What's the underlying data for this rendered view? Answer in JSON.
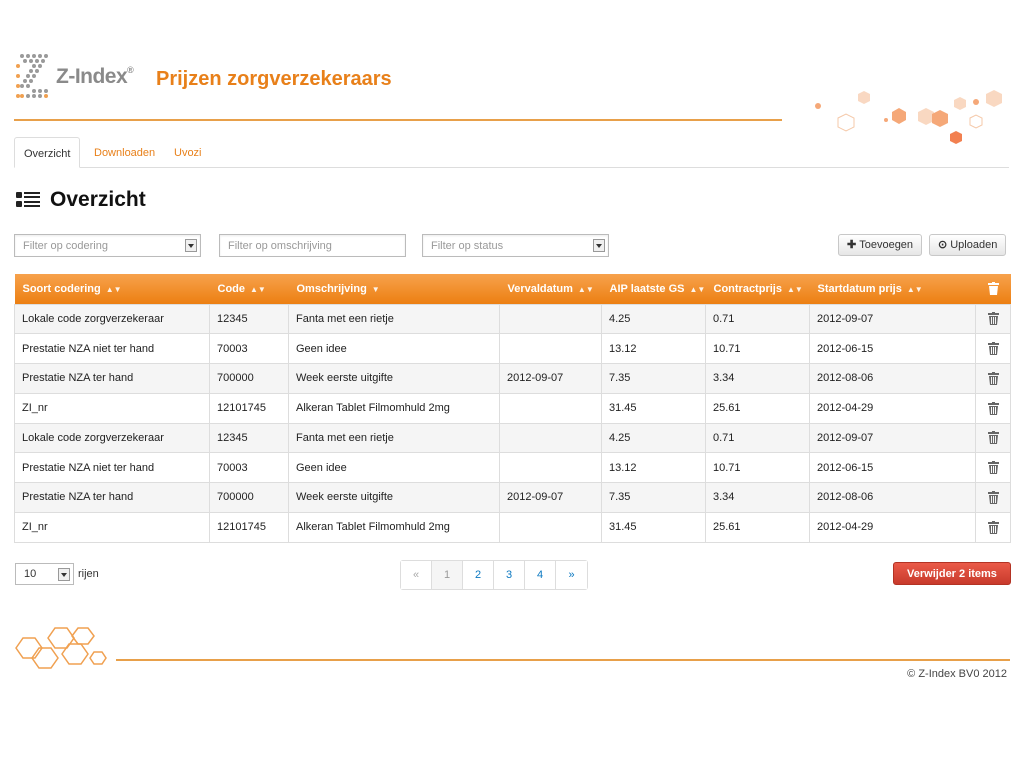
{
  "header": {
    "logo_text": "Z-Index",
    "logo_mark": "®",
    "app_title": "Prijzen zorgverzekeraars"
  },
  "tabs": [
    {
      "label": "Overzicht",
      "active": true
    },
    {
      "label": "Downloaden",
      "active": false
    },
    {
      "label": "Uvozi",
      "active": false
    }
  ],
  "page": {
    "title": "Overzicht",
    "title_icon": "list-icon"
  },
  "filters": {
    "codering": {
      "placeholder": "Filter op codering"
    },
    "omschrijving": {
      "placeholder": "Filter op omschrijving"
    },
    "status": {
      "placeholder": "Filter op status"
    }
  },
  "actions": {
    "add_label": "Toevoegen",
    "add_icon": "plus-icon",
    "upload_label": "Uploaden",
    "upload_icon": "upload-icon"
  },
  "table": {
    "columns": [
      "Soort codering",
      "Code",
      "Omschrijving",
      "Vervaldatum",
      "AIP laatste GS",
      "Contractprijs",
      "Startdatum prijs"
    ],
    "rows": [
      [
        "Lokale code zorgverzekeraar",
        "12345",
        "Fanta met een rietje",
        "",
        "4.25",
        "0.71",
        "2012-09-07"
      ],
      [
        "Prestatie NZA niet ter hand",
        "70003",
        "Geen idee",
        "",
        "13.12",
        "10.71",
        "2012-06-15"
      ],
      [
        "Prestatie NZA ter hand",
        "700000",
        "Week eerste uitgifte",
        "2012-09-07",
        "7.35",
        "3.34",
        "2012-08-06"
      ],
      [
        "ZI_nr",
        "12101745",
        "Alkeran Tablet Filmomhuld 2mg",
        "",
        "31.45",
        "25.61",
        "2012-04-29"
      ],
      [
        "Lokale code zorgverzekeraar",
        "12345",
        "Fanta met een rietje",
        "",
        "4.25",
        "0.71",
        "2012-09-07"
      ],
      [
        "Prestatie NZA niet ter hand",
        "70003",
        "Geen idee",
        "",
        "13.12",
        "10.71",
        "2012-06-15"
      ],
      [
        "Prestatie NZA ter hand",
        "700000",
        "Week eerste uitgifte",
        "2012-09-07",
        "7.35",
        "3.34",
        "2012-08-06"
      ],
      [
        "ZI_nr",
        "12101745",
        "Alkeran Tablet Filmomhuld 2mg",
        "",
        "31.45",
        "25.61",
        "2012-04-29"
      ]
    ]
  },
  "paging": {
    "per_page": "10",
    "per_page_label": "rijen",
    "prev": "«",
    "next": "»",
    "pages": [
      "1",
      "2",
      "3",
      "4"
    ],
    "current": "1"
  },
  "bulk": {
    "delete_label": "Verwijder 2  items"
  },
  "footer": {
    "copyright": "© Z-Index BV0 2012"
  },
  "colors": {
    "accent": "#e8801a",
    "header_gradient_top": "#f7a24c",
    "header_gradient_bottom": "#ec7f12",
    "danger": "#d9463a",
    "link": "#0b78c1"
  }
}
